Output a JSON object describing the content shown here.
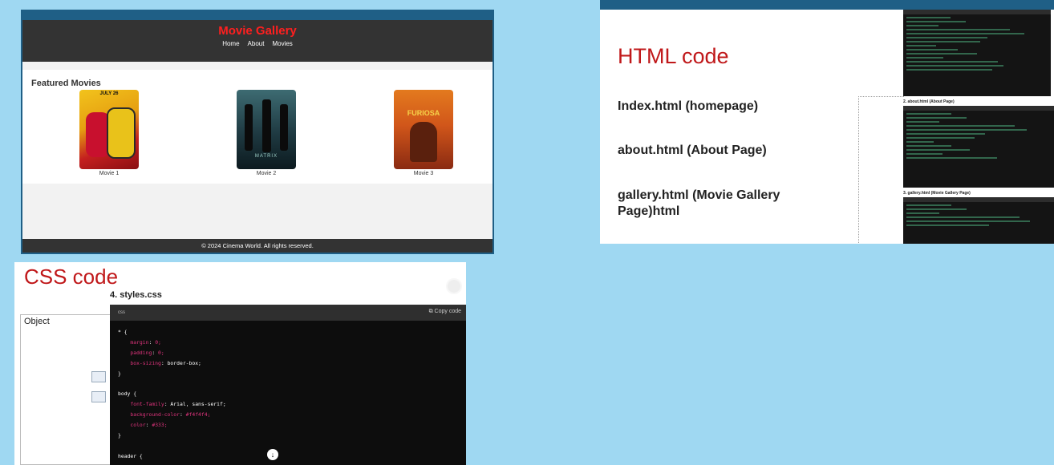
{
  "gallery": {
    "title": "Movie Gallery",
    "nav": [
      "Home",
      "About",
      "Movies"
    ],
    "featured_heading": "Featured Movies",
    "poster_text_1": "JULY 26",
    "poster_text_2": "MATRIX",
    "poster_text_3": "FURIOSA",
    "movies": [
      "Movie 1",
      "Movie 2",
      "Movie 3"
    ],
    "footer": "© 2024 Cinema World. All rights reserved."
  },
  "html_slide": {
    "title": "HTML code",
    "items": [
      "Index.html (homepage)",
      "about.html (About Page)",
      "gallery.html (Movie Gallery Page)html"
    ],
    "captions": [
      "2. about.html (About Page)",
      "3. gallery.html (Movie Gallery Page)"
    ]
  },
  "css_slide": {
    "title": "CSS code",
    "file_heading": "4. styles.css",
    "object_label": "Object",
    "code_lang": "css",
    "copy_label": "Copy code",
    "code_lines": [
      "* {",
      "    margin: 0;",
      "    padding: 0;",
      "    box-sizing: border-box;",
      "}",
      "",
      "body {",
      "    font-family: Arial, sans-serif;",
      "    background-color: #f4f4f4;",
      "    color: #333;",
      "}",
      "",
      "header {"
    ]
  },
  "colors": {
    "background": "#9fd8f2",
    "accent_red": "#c0181a",
    "header_dark": "#333333",
    "frame_blue": "#1f5f86"
  },
  "icons": [
    "scroll-down-icon",
    "copy-icon",
    "loading-spinner-icon",
    "object-image-icon",
    "object-frame-icon"
  ]
}
